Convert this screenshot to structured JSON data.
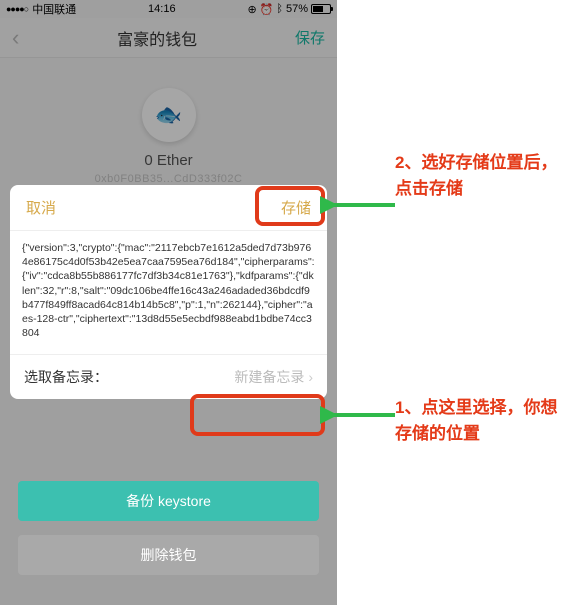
{
  "status": {
    "carrier": "中国联通",
    "time": "14:16",
    "battery_pct": "57%"
  },
  "nav": {
    "title": "富豪的钱包",
    "save": "保存"
  },
  "wallet": {
    "balance": "0 Ether",
    "address": "0xb0F0BB35...CdD333f02C"
  },
  "dialog": {
    "cancel": "取消",
    "store": "存储",
    "json_text": "{\"version\":3,\"crypto\":{\"mac\":\"2117ebcb7e1612a5ded7d73b9764e86175c4d0f53b42e5ea7caa7595ea76d184\",\"cipherparams\":{\"iv\":\"cdca8b55b886177fc7df3b34c81e1763\"},\"kdfparams\":{\"dklen\":32,\"r\":8,\"salt\":\"09dc106be4ffe16c43a246adaded36bdcdf9b477f849ff8acad64c814b14b5c8\",\"p\":1,\"n\":262144},\"cipher\":\"aes-128-ctr\",\"ciphertext\":\"13d8d55e5ecbdf988eabd1bdbe74cc3804",
    "memo_label": "选取备忘录：",
    "memo_button": "新建备忘录"
  },
  "buttons": {
    "backup": "备份 keystore",
    "delete": "删除钱包"
  },
  "annotations": {
    "a1": "2、选好存储位置后，点击存储",
    "a2": "1、点这里选择，你想存储的位置"
  }
}
